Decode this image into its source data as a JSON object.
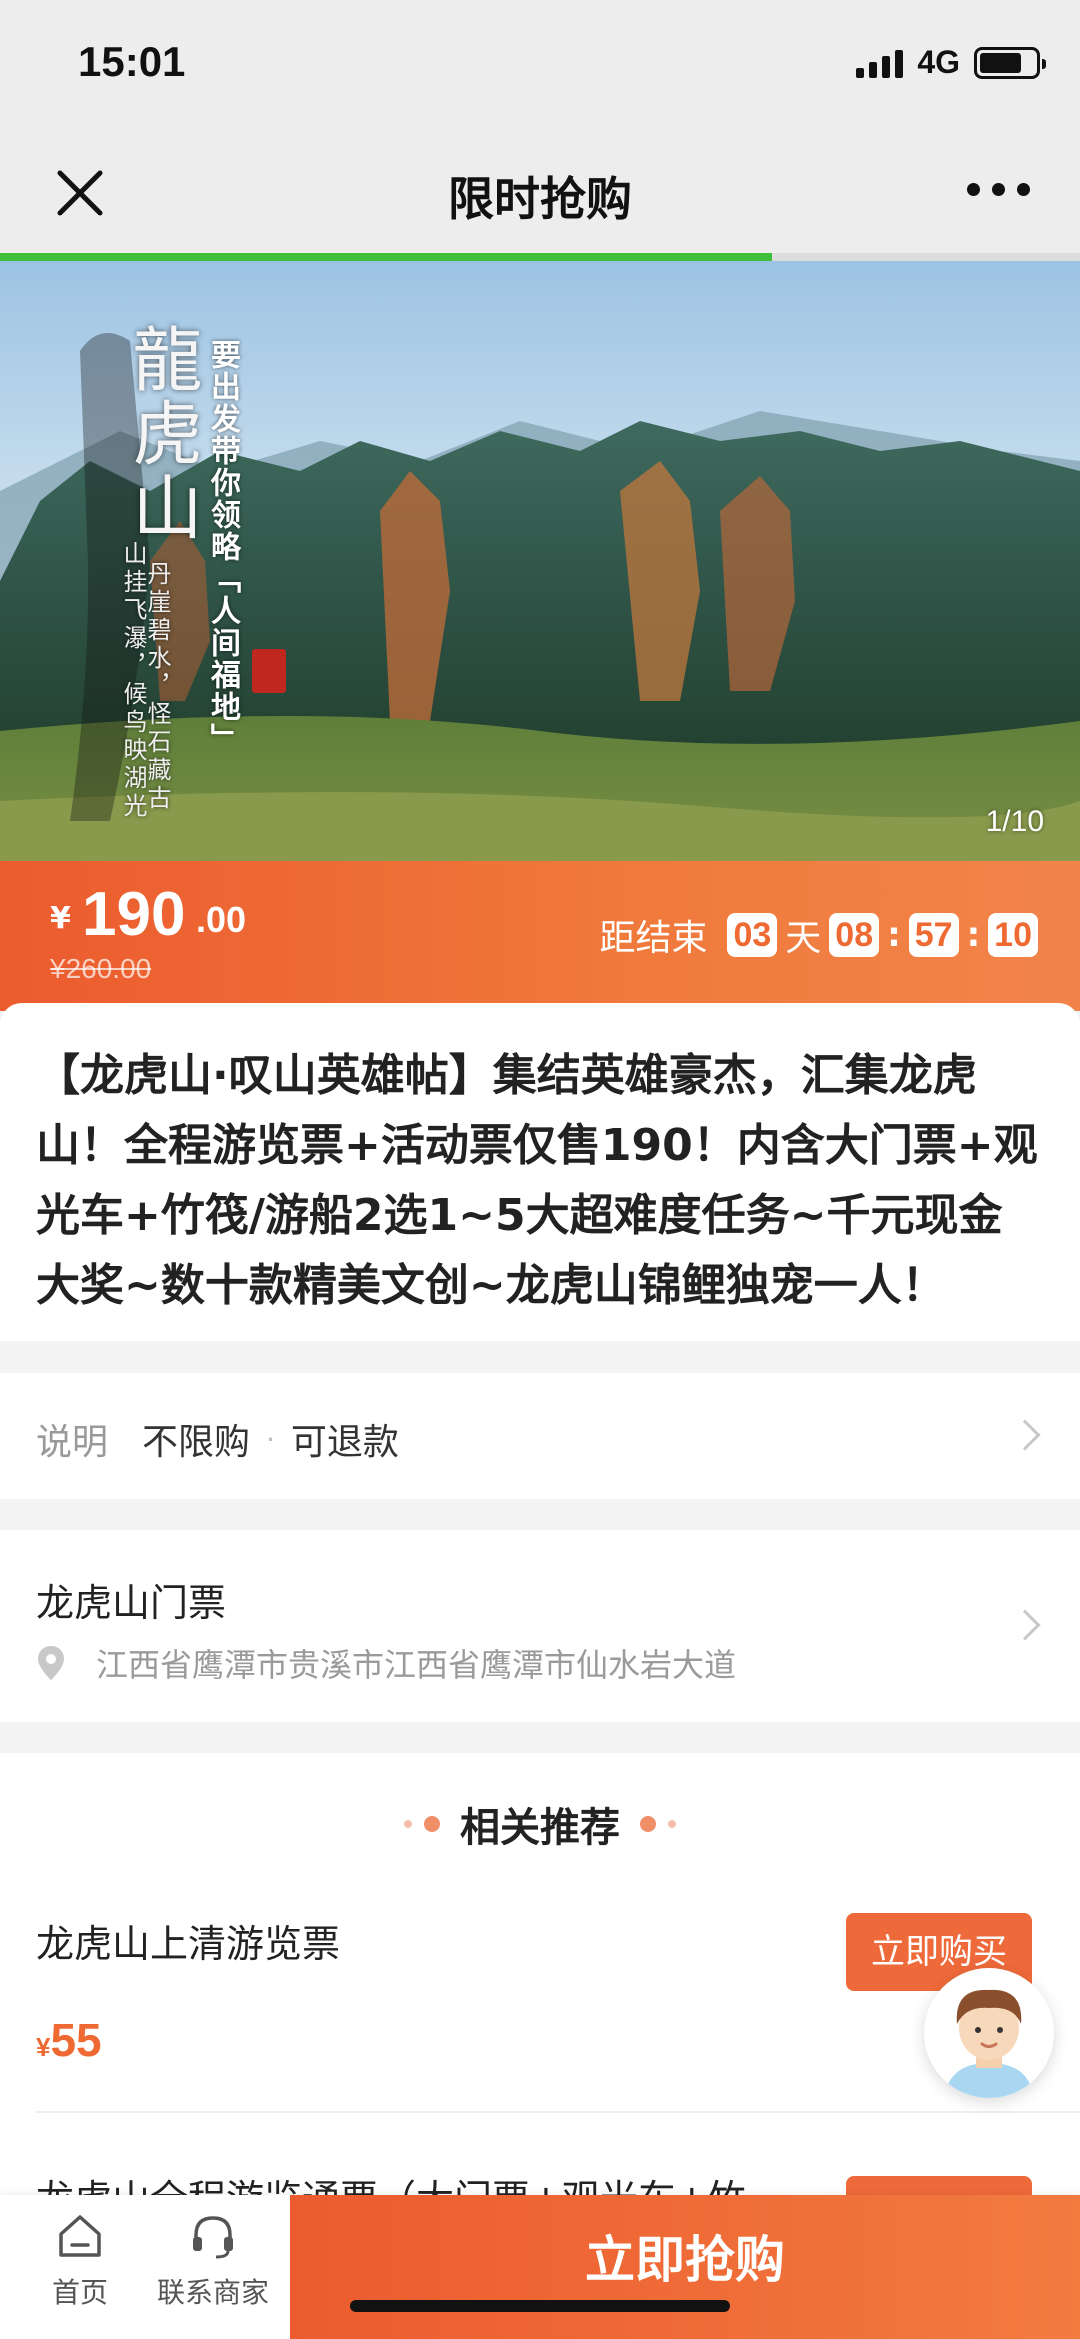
{
  "status_bar": {
    "time": "15:01",
    "network": "4G",
    "battery_level": 0.75
  },
  "nav": {
    "title": "限时抢购",
    "close_icon": "close-icon",
    "more_icon": "more-dots-icon",
    "load_progress": 0.715
  },
  "hero": {
    "title": "龍虎山",
    "slogan": "要出发带你领略「人间福地」",
    "verse_lines": [
      "山挂飞瀑，候鸟映湖光",
      "丹崖碧水，怪石藏古"
    ],
    "counter": "1/10"
  },
  "price": {
    "symbol": "¥",
    "integer": "190",
    "decimal": ".00",
    "original": "¥260.00",
    "countdown_label": "距结束",
    "days": "03",
    "days_unit": "天",
    "hours": "08",
    "minutes": "57",
    "seconds": "10",
    "separator": ":"
  },
  "description": "【龙虎山·叹山英雄帖】集结英雄豪杰，汇集龙虎山！全程游览票+活动票仅售190！内含大门票+观光车+竹筏/游船2选1~5大超难度任务~千元现金大奖~数十款精美文创~龙虎山锦鲤独宠一人！",
  "notes": {
    "label": "说明",
    "item1": "不限购",
    "separator": "·",
    "item2": "可退款"
  },
  "venue": {
    "name": "龙虎山门票",
    "address": "江西省鹰潭市贵溪市江西省鹰潭市仙水岩大道"
  },
  "recommend": {
    "title": "相关推荐",
    "items": [
      {
        "name": "龙虎山上清游览票",
        "price_symbol": "¥",
        "price": "55",
        "button": "立即购买"
      },
      {
        "name": "龙虎山全程游览通票（大门票+观光车+竹",
        "button": ""
      }
    ]
  },
  "bottom_bar": {
    "home_label": "首页",
    "contact_label": "联系商家",
    "grab_button": "立即抢购"
  },
  "colors": {
    "accent": "#EF6A33",
    "progress": "#3FBF3A",
    "background": "#F4F4F4"
  }
}
